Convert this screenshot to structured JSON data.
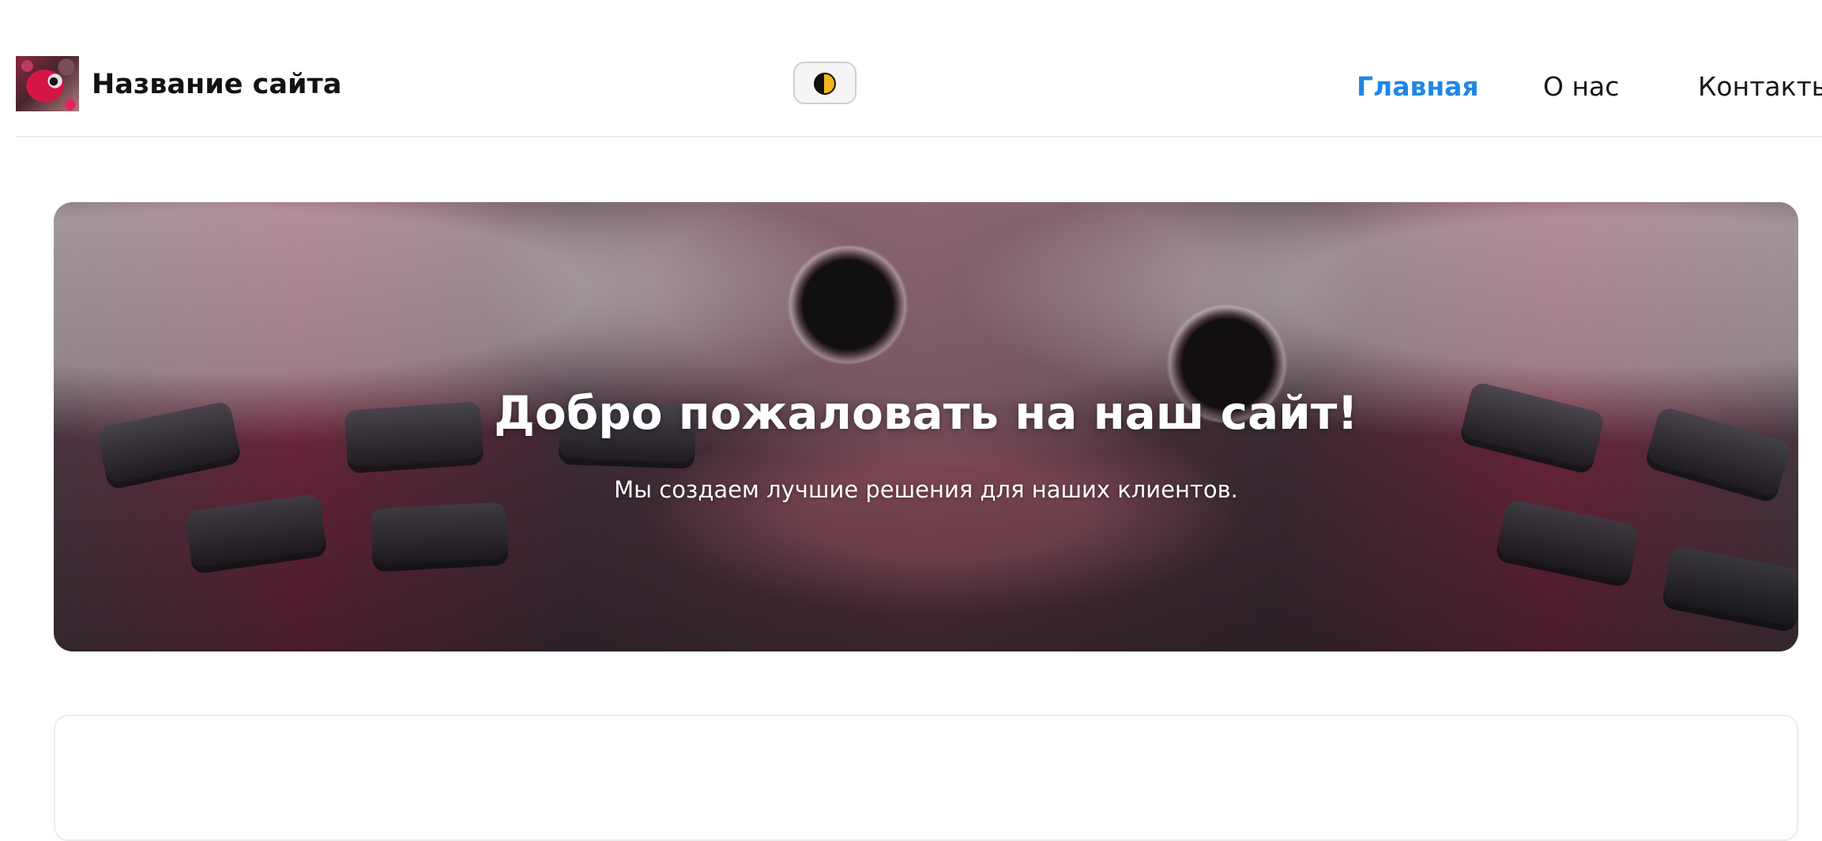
{
  "header": {
    "site_title": "Название сайта",
    "logo_icon": "cat-avatar-icon",
    "theme_toggle_icon": "half-moon-theme-icon"
  },
  "nav": {
    "items": [
      {
        "label": "Главная",
        "active": true
      },
      {
        "label": "О нас",
        "active": false
      },
      {
        "label": "Контакты",
        "active": false
      }
    ]
  },
  "hero": {
    "title": "Добро пожаловать на наш сайт!",
    "subtitle": "Мы создаем лучшие решения для наших клиентов."
  },
  "colors": {
    "accent": "#1f87e5",
    "text": "#121212",
    "border": "#ececec",
    "toggle_border": "#cfcfcf"
  }
}
